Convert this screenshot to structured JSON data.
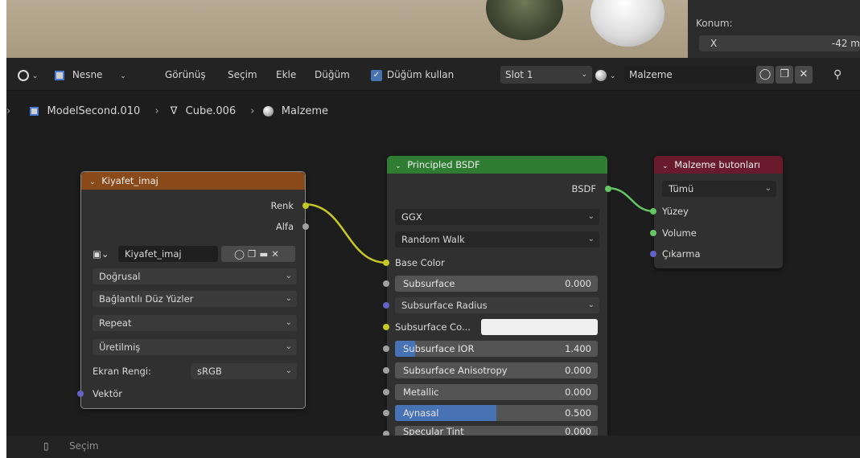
{
  "viewport": {
    "npanel_label": "Konum:",
    "x_label": "X",
    "x_value": "-42 m"
  },
  "header": {
    "editor_type_icon": "node-editor-icon",
    "mode_label": "Nesne",
    "menus": [
      "Görünüş",
      "Seçim",
      "Ekle",
      "Düğüm"
    ],
    "use_nodes_label": "Düğüm kullan",
    "use_nodes_checked": true,
    "slot_label": "Slot 1",
    "material_name": "Malzeme"
  },
  "breadcrumb": {
    "object": "ModelSecond.010",
    "mesh": "Cube.006",
    "material": "Malzeme"
  },
  "image_node": {
    "title": "Kiyafet_imaj",
    "out_color": "Renk",
    "out_alpha": "Alfa",
    "image_name": "Kiyafet_imaj",
    "interpolation": "Doğrusal",
    "projection": "Bağlantılı Düz Yüzler",
    "extension": "Repeat",
    "source": "Üretilmiş",
    "colorspace_label": "Ekran Rengi:",
    "colorspace_value": "sRGB",
    "in_vector": "Vektör"
  },
  "bsdf_node": {
    "title": "Principled BSDF",
    "out_bsdf": "BSDF",
    "distribution": "GGX",
    "subsurface_method": "Random Walk",
    "base_color": "Base Color",
    "subsurface": {
      "label": "Subsurface",
      "value": "0.000"
    },
    "subsurface_radius": "Subsurface Radius",
    "subsurface_color": "Subsurface Co...",
    "subsurface_ior": {
      "label": "Subsurface IOR",
      "value": "1.400",
      "fill": 0.1
    },
    "subsurface_anisotropy": {
      "label": "Subsurface Anisotropy",
      "value": "0.000"
    },
    "metallic": {
      "label": "Metallic",
      "value": "0.000"
    },
    "specular": {
      "label": "Aynasal",
      "value": "0.500",
      "fill": 0.5
    },
    "specular_tint": {
      "label": "Specular Tint",
      "value": "0.000"
    }
  },
  "output_node": {
    "title": "Malzeme butonları",
    "target": "Tümü",
    "in_surface": "Yüzey",
    "in_volume": "Volume",
    "in_displacement": "Çıkarma"
  },
  "status": {
    "label": "Seçim"
  },
  "colors": {
    "image_header": "#8a4a1a",
    "bsdf_header": "#2e7d32",
    "output_header": "#6a1b2b",
    "socket_color": "#c7c729",
    "socket_shader": "#63c763",
    "socket_vector": "#6363c7"
  }
}
